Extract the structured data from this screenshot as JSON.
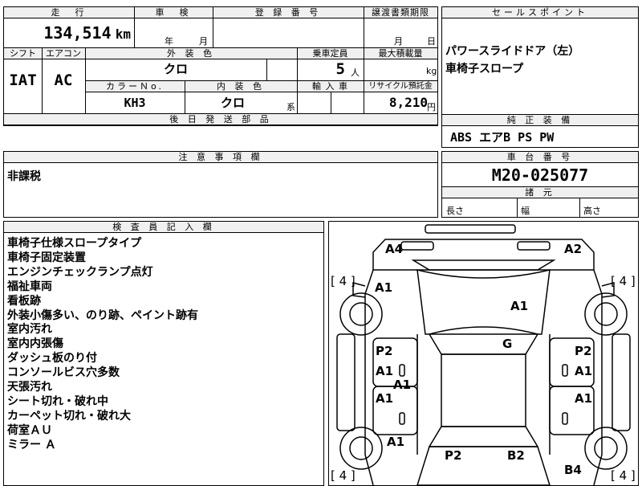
{
  "top": {
    "mileage_header": "走　行",
    "mileage_value": "134,514",
    "mileage_unit": "km",
    "inspection_header": "車　検",
    "inspection_year": "年",
    "inspection_month": "月",
    "registration_header": "登 録 番 号",
    "transfer_header": "譲渡書類期限",
    "transfer_month": "月",
    "transfer_day": "日",
    "shift_header": "シフト",
    "ac_header": "エアコン",
    "exterior_header": "外 装 色",
    "capacity_header": "乗車定員",
    "max_load_header": "最大積載量",
    "shift_value": "IAT",
    "ac_value": "AC",
    "exterior_value": "クロ",
    "capacity_value": "5",
    "capacity_unit": "人",
    "max_load_unit": "kg",
    "color_no_header": "カラーＮo.",
    "interior_header": "内 装 色",
    "import_header": "輸 入 車",
    "recycle_header": "リサイクル預託金",
    "color_no_value": "KH3",
    "interior_value": "クロ",
    "interior_suffix": "系",
    "recycle_value": "8,210",
    "recycle_unit": "円",
    "later_parts_header": "後 日 発 送 部 品"
  },
  "sales": {
    "header": "セールスポイント",
    "lines": [
      "パワースライドドア（左）",
      "車椅子スロープ"
    ]
  },
  "equipment": {
    "header": "純 正 装 備",
    "value": "ABS エアB PS PW"
  },
  "notes": {
    "header": "注 意 事 項 欄",
    "value": "非課税"
  },
  "chassis": {
    "header": "車 台 番 号",
    "value": "M20-025077",
    "dims_header": "諸 元",
    "length": "長さ",
    "width": "幅",
    "height": "高さ"
  },
  "inspector": {
    "header": "検 査 員 記 入 欄",
    "lines": [
      "車椅子仕様スロープタイプ",
      "車椅子固定装置",
      "エンジンチェックランプ点灯",
      "福祉車両",
      "看板跡",
      "外装小傷多い、のり跡、ペイント跡有",
      "室内汚れ",
      "室内内張傷",
      "ダッシュ板のり付",
      "コンソールビス穴多数",
      "天張汚れ",
      "シート切れ・破れ中",
      "カーペット切れ・破れ大",
      "荷室ＡＵ",
      "ミラー Ａ"
    ]
  },
  "diagram": {
    "tire_labels": [
      "[ 4 ]",
      "[ 4 ]",
      "[ 4 ]",
      "[ 4 ]"
    ],
    "marks": [
      "A4",
      "A2",
      "A1",
      "A1",
      "G",
      "P2",
      "A1",
      "P2",
      "A1",
      "A1",
      "A1",
      "A1",
      "A1",
      "P2",
      "B2",
      "B4"
    ]
  }
}
